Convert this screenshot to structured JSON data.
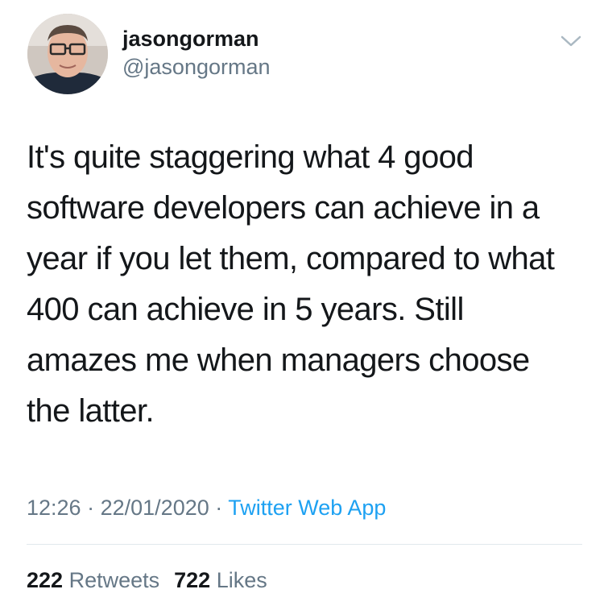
{
  "author": {
    "display_name": "jasongorman",
    "handle": "@jasongorman",
    "avatar_icon": "profile-photo"
  },
  "menu_icon": "chevron-down-icon",
  "tweet": {
    "text": "It's quite staggering what 4 good\nsoftware developers can achieve in a\nyear if you let them, compared to what\n400 can achieve in 5 years. Still\namazes me when managers choose\nthe latter."
  },
  "meta": {
    "time": "12:26",
    "separator": "·",
    "date": "22/01/2020",
    "source": "Twitter Web App"
  },
  "stats": {
    "retweets_count": "222",
    "retweets_label": "Retweets",
    "likes_count": "722",
    "likes_label": "Likes"
  },
  "colors": {
    "text": "#14171a",
    "secondary": "#657786",
    "link": "#1da1f2",
    "divider": "#e1e8ed"
  }
}
